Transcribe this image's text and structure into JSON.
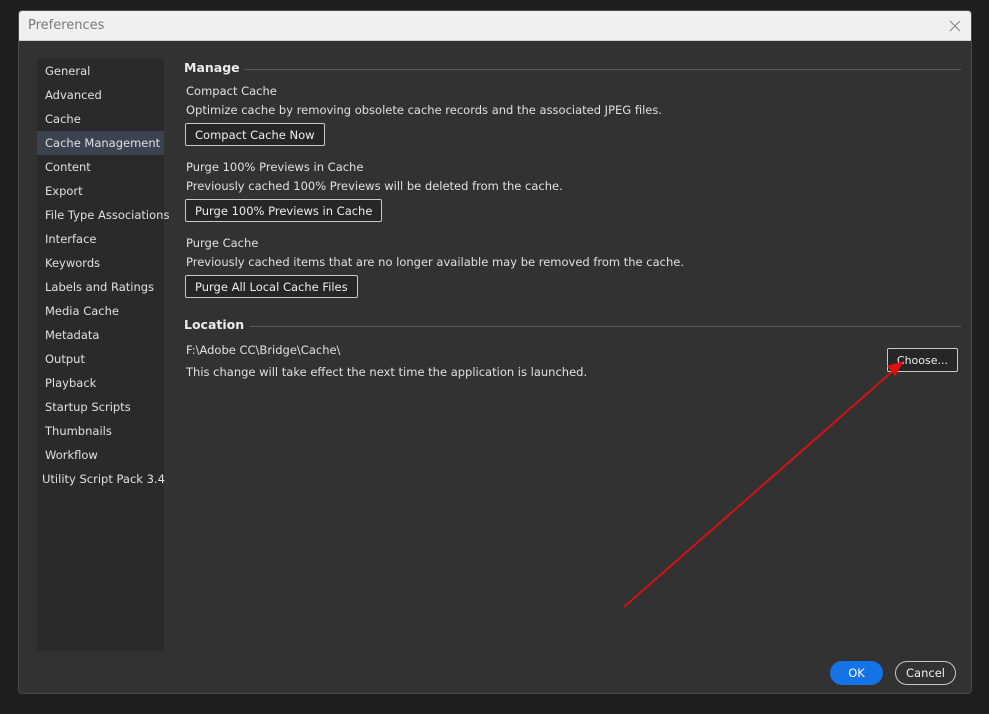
{
  "window": {
    "title": "Preferences"
  },
  "sidebar": {
    "items": [
      {
        "label": "General",
        "selected": false
      },
      {
        "label": "Advanced",
        "selected": false
      },
      {
        "label": "Cache",
        "selected": false
      },
      {
        "label": "Cache Management",
        "selected": true
      },
      {
        "label": "Content",
        "selected": false
      },
      {
        "label": "Export",
        "selected": false
      },
      {
        "label": "File Type Associations",
        "selected": false
      },
      {
        "label": "Interface",
        "selected": false
      },
      {
        "label": "Keywords",
        "selected": false
      },
      {
        "label": "Labels and Ratings",
        "selected": false
      },
      {
        "label": "Media Cache",
        "selected": false
      },
      {
        "label": "Metadata",
        "selected": false
      },
      {
        "label": "Output",
        "selected": false
      },
      {
        "label": "Playback",
        "selected": false
      },
      {
        "label": "Startup Scripts",
        "selected": false
      },
      {
        "label": "Thumbnails",
        "selected": false
      },
      {
        "label": "Workflow",
        "selected": false
      },
      {
        "label": "Utility Script Pack 3.4",
        "selected": false
      }
    ]
  },
  "manage": {
    "header": "Manage",
    "compact": {
      "title": "Compact Cache",
      "description": "Optimize cache by removing obsolete cache records and the associated JPEG files.",
      "button": "Compact Cache Now"
    },
    "purge_previews": {
      "title": "Purge 100% Previews in Cache",
      "description": "Previously cached 100% Previews will be deleted from the cache.",
      "button": "Purge 100% Previews in Cache"
    },
    "purge_cache": {
      "title": "Purge Cache",
      "description": "Previously cached items that are no longer available may be removed from the cache.",
      "button": "Purge All Local Cache Files"
    }
  },
  "location": {
    "header": "Location",
    "path": "F:\\Adobe CC\\Bridge\\Cache\\",
    "note": "This change will take effect the next time the application is launched.",
    "choose_button": "Choose..."
  },
  "footer": {
    "ok": "OK",
    "cancel": "Cancel"
  },
  "colors": {
    "accent": "#1473e6",
    "annotation_arrow": "#e01010",
    "selected_item": "#3b4350"
  },
  "icons": {
    "close": "close-icon",
    "arrow": "arrow-annotation"
  }
}
